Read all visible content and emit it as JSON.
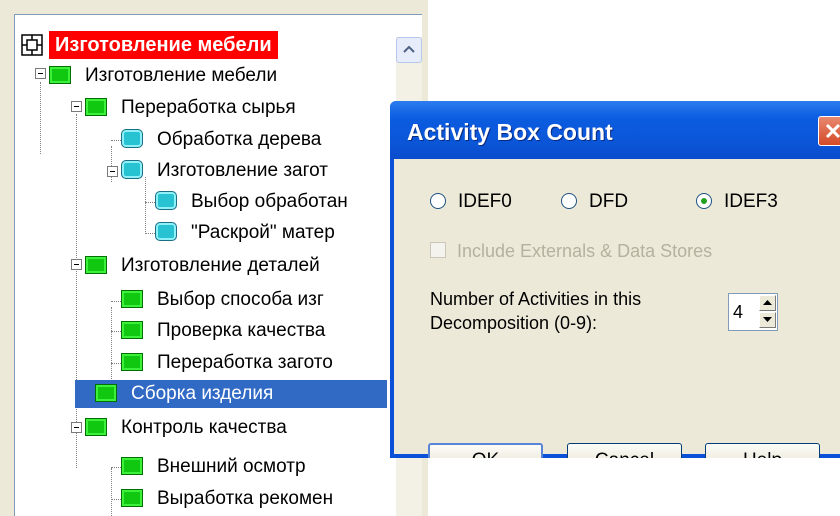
{
  "tree": {
    "items": [
      {
        "label": "Изготовление мебели",
        "kind": "root"
      },
      {
        "label": "Изготовление мебели",
        "kind": "green"
      },
      {
        "label": "Переработка сырья",
        "kind": "green"
      },
      {
        "label": "Обработка дерева",
        "kind": "cyan"
      },
      {
        "label": "Изготовление загот",
        "kind": "cyan"
      },
      {
        "label": "Выбор обработан",
        "kind": "cyan"
      },
      {
        "label": "\"Раскрой\" матер",
        "kind": "cyan"
      },
      {
        "label": "Изготовление деталей",
        "kind": "green"
      },
      {
        "label": "Выбор  способа изг",
        "kind": "green"
      },
      {
        "label": "Проверка  качества",
        "kind": "green"
      },
      {
        "label": "Переработка загото",
        "kind": "green"
      },
      {
        "label": "Сборка изделия",
        "kind": "green",
        "selected": true
      },
      {
        "label": "Контроль качества",
        "kind": "green"
      },
      {
        "label": "Внешний осмотр",
        "kind": "green"
      },
      {
        "label": "Выработка  рекомен",
        "kind": "green"
      }
    ]
  },
  "dialog": {
    "title": "Activity Box Count",
    "radios": [
      {
        "label": "IDEF0",
        "checked": false
      },
      {
        "label": "DFD",
        "checked": false
      },
      {
        "label": "IDEF3",
        "checked": true
      }
    ],
    "include_externals": {
      "label": "Include Externals & Data Stores",
      "checked": false,
      "disabled": true
    },
    "activities": {
      "label_line1": "Number of Activities in this",
      "label_line2": "Decomposition (0-9):",
      "value": "4"
    },
    "buttons": {
      "ok": "OK",
      "cancel": "Cancel",
      "help": "Help"
    }
  },
  "colors": {
    "selection": "#316ac5",
    "root_highlight": "#ff0000",
    "title_bar": "#0b56d8",
    "dialog_face": "#ece9d8"
  }
}
